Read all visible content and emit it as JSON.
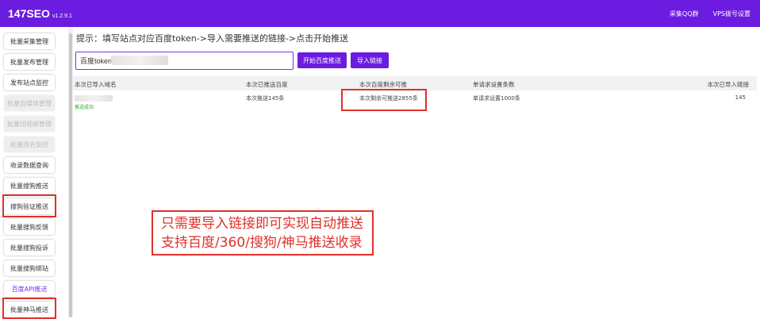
{
  "header": {
    "title": "147SEO",
    "version": "v1.2.9.1",
    "links": [
      "采集QQ群",
      "VPS拨号设置"
    ],
    "bg_color": "#6c1be0"
  },
  "sidebar": {
    "items": [
      {
        "label": "批量采集管理",
        "state": "normal"
      },
      {
        "label": "批量发布管理",
        "state": "normal"
      },
      {
        "label": "发布站点监控",
        "state": "normal"
      },
      {
        "label": "批量自媒体管理",
        "state": "disabled"
      },
      {
        "label": "批量短视频管理",
        "state": "disabled"
      },
      {
        "label": "批量排名监控",
        "state": "disabled"
      },
      {
        "label": "收录数据查询",
        "state": "normal"
      },
      {
        "label": "批量搜狗推送",
        "state": "normal"
      },
      {
        "label": "搜狗验证推送",
        "state": "normal",
        "highlighted": true
      },
      {
        "label": "批量搜狗反馈",
        "state": "normal"
      },
      {
        "label": "批量搜狗投诉",
        "state": "normal"
      },
      {
        "label": "批量搜狗绑站",
        "state": "normal"
      },
      {
        "label": "百度API推送",
        "state": "active"
      },
      {
        "label": "批量神马推送",
        "state": "normal",
        "highlighted": true
      }
    ],
    "active_color": "#7b2ff0"
  },
  "main": {
    "hint": "提示：填写站点对应百度token->导入需要推送的链接->点击开始推送",
    "token_input_value": "百度tokenff",
    "buttons": {
      "start_push": "开始百度推送",
      "import_links": "导入链接"
    },
    "table": {
      "headers": [
        "本次已导入域名",
        "本次已推送百度",
        "本次百度剩余可推",
        "单请求设置条数",
        "本次已导入链接"
      ],
      "rows": [
        {
          "domain": "",
          "status": "推送成功",
          "pushed": "本次推送145条",
          "remaining": "本次剩余可推送2855条",
          "per_request": "单请求设置1000条",
          "imported": "145"
        }
      ]
    },
    "callout": {
      "line1": "只需要导入链接即可实现自动推送",
      "line2": "支持百度/360/搜狗/神马推送收录"
    }
  },
  "colors": {
    "accent": "#6c1be0",
    "highlight_border": "#e0302b",
    "success": "#27a827"
  }
}
